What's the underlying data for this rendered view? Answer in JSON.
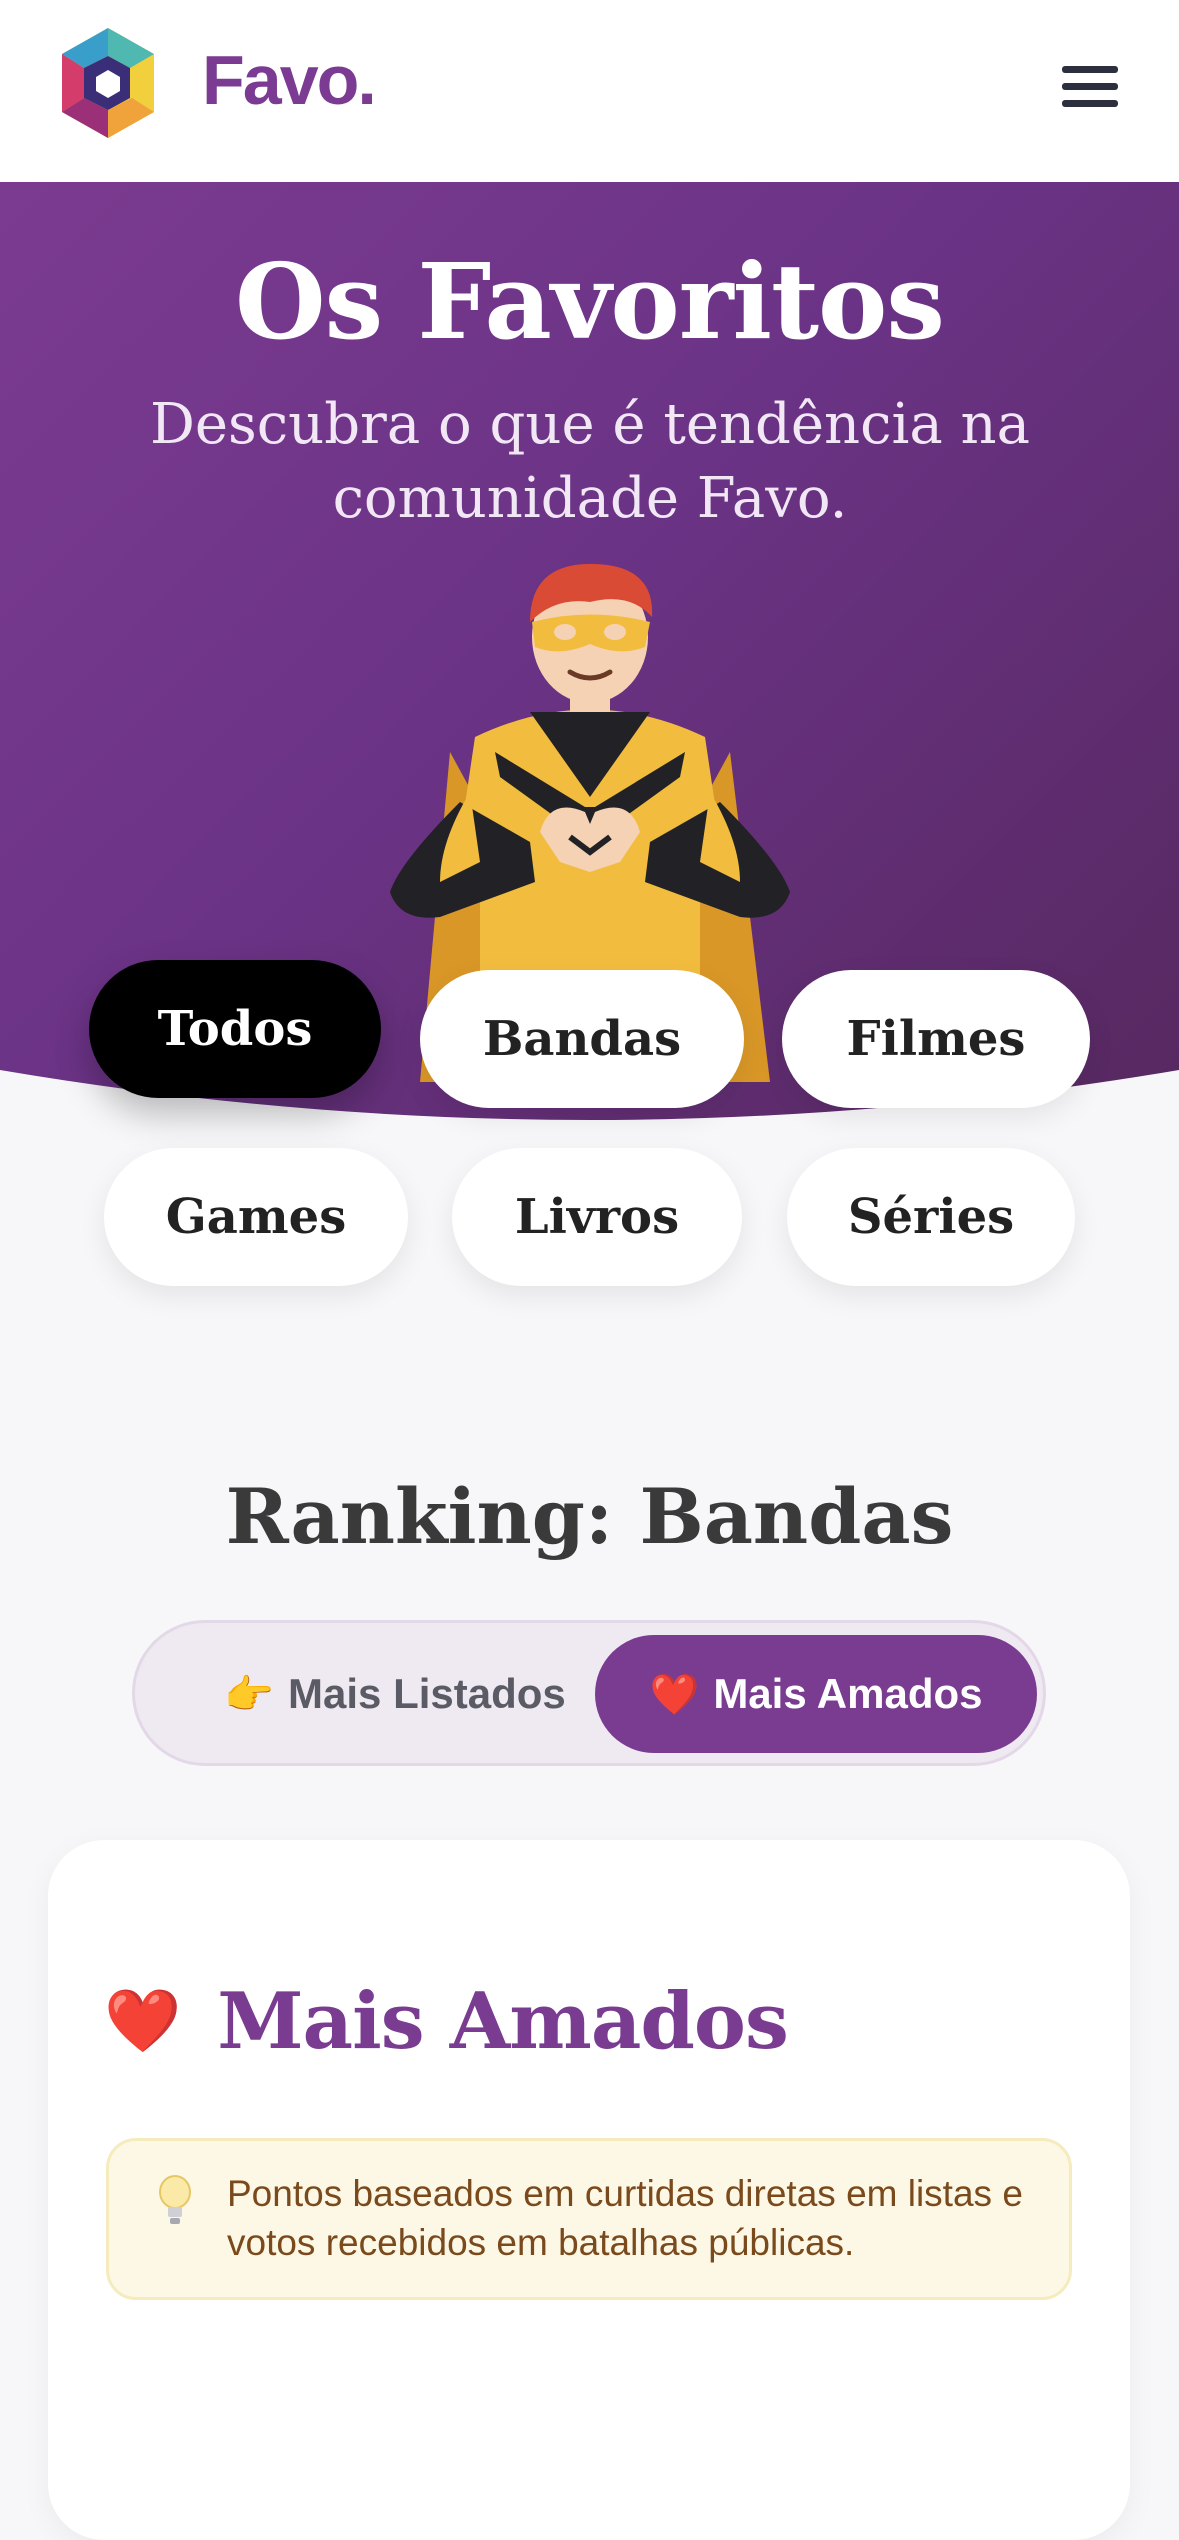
{
  "header": {
    "brand": "Favo.",
    "logo_icon": "favo-logo-icon",
    "menu_icon": "hamburger-menu-icon"
  },
  "hero": {
    "title": "Os Favoritos",
    "subtitle": "Descubra o que é tendência na comunidade Favo.",
    "illustration": "superhero-heart-hands-illustration"
  },
  "filters": {
    "items": [
      {
        "label": "Todos",
        "active": true
      },
      {
        "label": "Bandas",
        "active": false
      },
      {
        "label": "Filmes",
        "active": false
      },
      {
        "label": "Games",
        "active": false
      },
      {
        "label": "Livros",
        "active": false
      },
      {
        "label": "Séries",
        "active": false
      }
    ]
  },
  "ranking": {
    "title": "Ranking: Bandas",
    "toggle": {
      "most_listed": {
        "emoji": "👉",
        "label": "Mais Listados"
      },
      "most_loved": {
        "emoji": "❤️",
        "label": "Mais Amados",
        "active": true
      }
    }
  },
  "card": {
    "heading_emoji": "❤️",
    "heading": "Mais Amados",
    "info": "Pontos baseados em curtidas diretas em listas e votos recebidos em batalhas públicas.",
    "info_icon": "lightbulb-icon"
  },
  "colors": {
    "brand_purple": "#7a3c91",
    "hero_gradient_start": "#7b3b90",
    "hero_gradient_end": "#56285f",
    "active_pill": "#000000",
    "info_bg": "#fdf8e5",
    "info_text": "#7a4a1c"
  }
}
